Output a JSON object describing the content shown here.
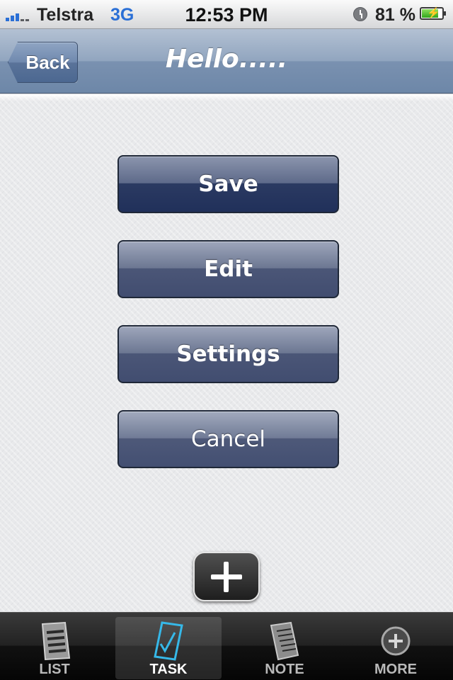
{
  "status_bar": {
    "carrier": "Telstra",
    "network": "3G",
    "time": "12:53 PM",
    "battery_percent": "81 %",
    "battery_level": 0.81,
    "signal_bars": 3,
    "icons": [
      "signal-icon",
      "alarm-clock-icon",
      "battery-charging-icon"
    ]
  },
  "nav_bar": {
    "back_label": "Back",
    "title": "Hello....."
  },
  "menu": {
    "save_label": "Save",
    "edit_label": "Edit",
    "settings_label": "Settings",
    "cancel_label": "Cancel"
  },
  "add_button": {
    "icon": "plus-icon"
  },
  "tab_bar": {
    "tabs": [
      {
        "label": "LIST",
        "icon": "list-icon",
        "active": false
      },
      {
        "label": "TASK",
        "icon": "task-icon",
        "active": true
      },
      {
        "label": "NOTE",
        "icon": "note-icon",
        "active": false
      },
      {
        "label": "MORE",
        "icon": "more-icon",
        "active": false
      }
    ],
    "colors": {
      "active": "#ffffff",
      "inactive": "#b9b9b9",
      "task_icon_accent": "#36b8e8"
    }
  }
}
